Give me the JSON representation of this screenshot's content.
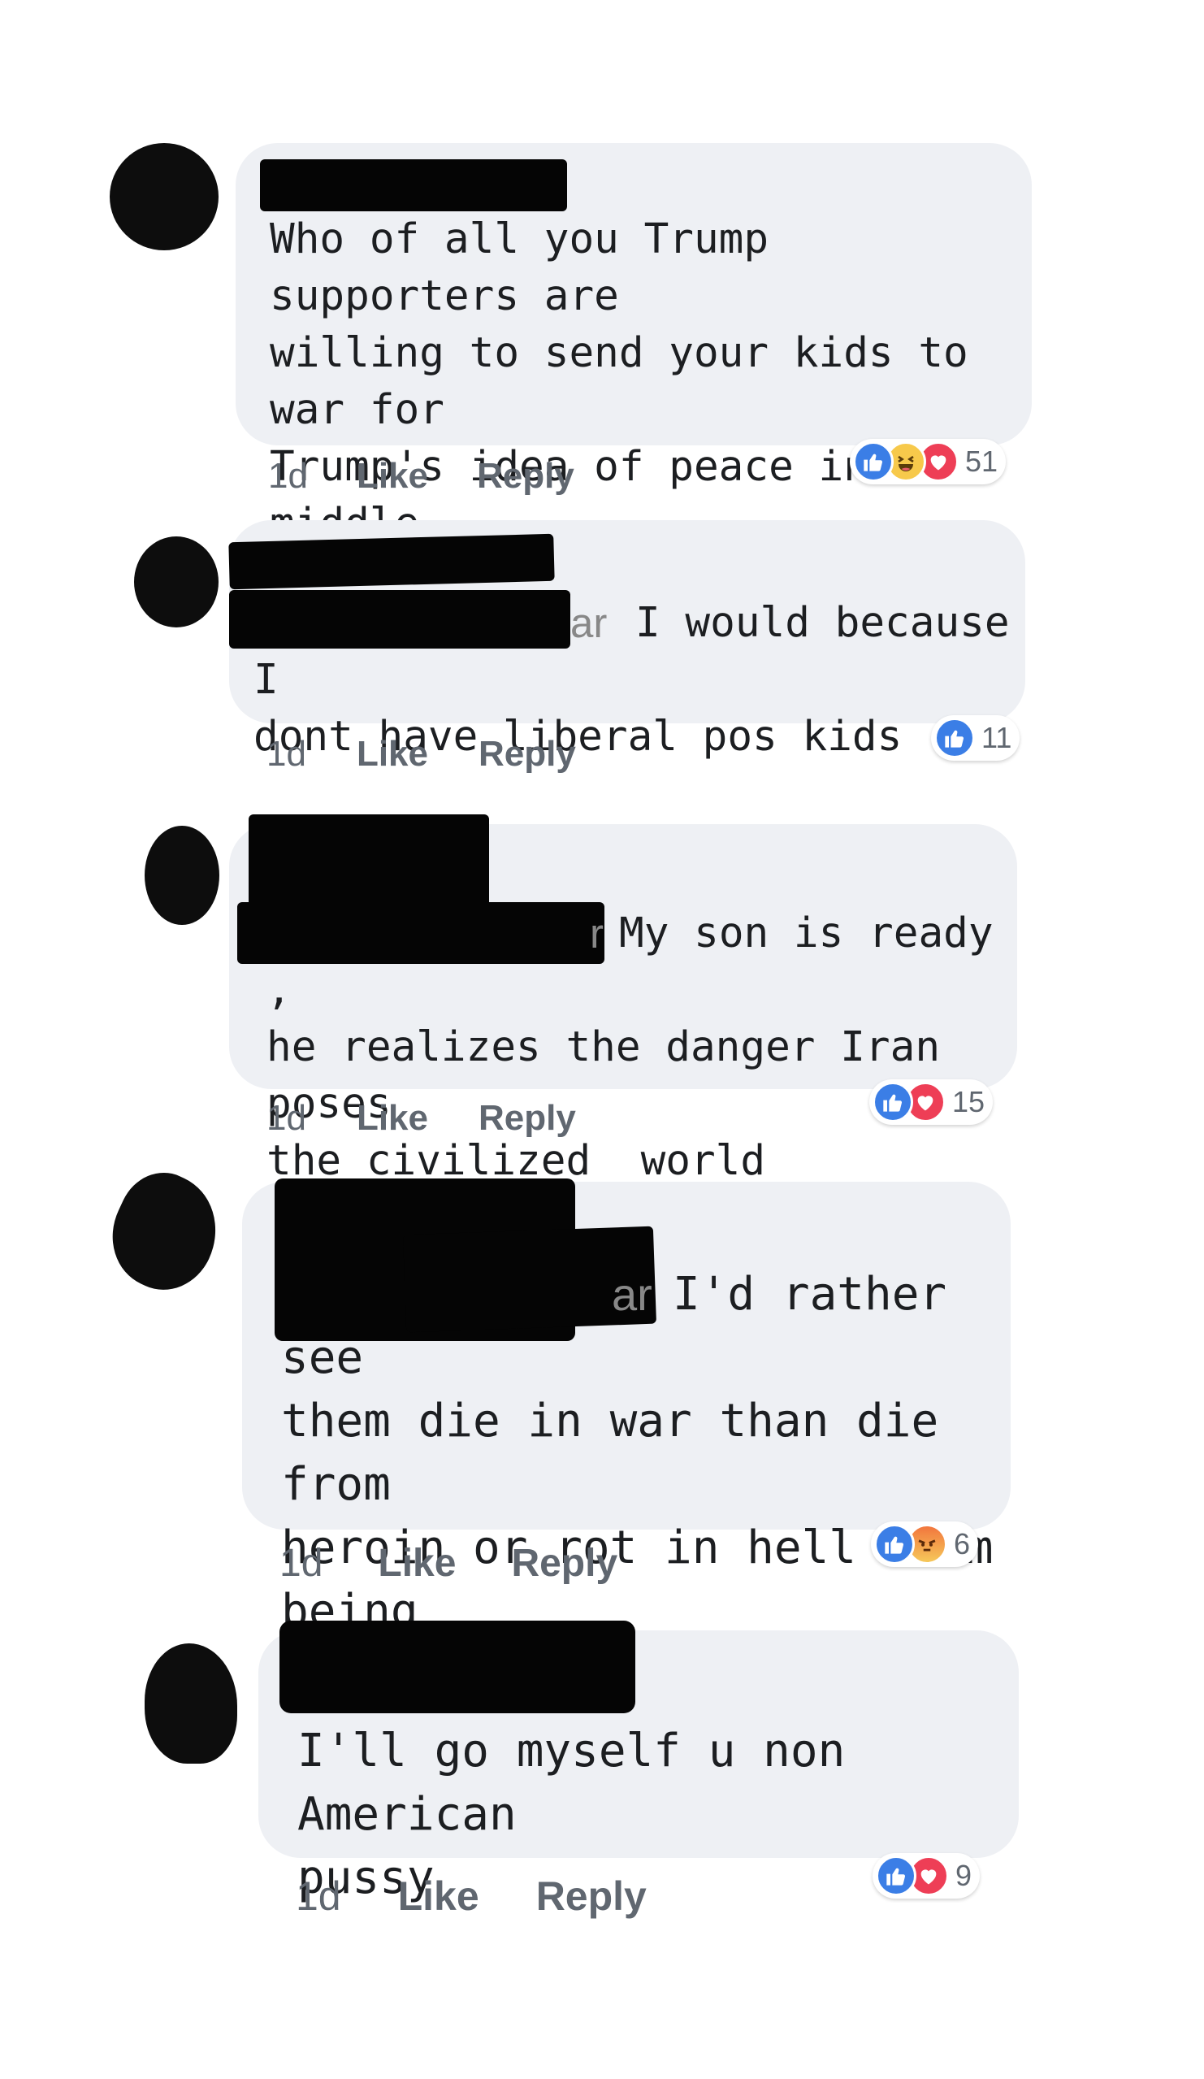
{
  "comments": [
    {
      "text": "Who of all you Trump supporters are\nwilling to send your kids to war for\nTrump's idea of peace in the middle\neast?",
      "time": "1d",
      "like_label": "Like",
      "reply_label": "Reply",
      "reactions": [
        "like-icon",
        "haha-icon",
        "love-icon"
      ],
      "reaction_count": "51"
    },
    {
      "text_fragment": "ar",
      "text": "I would because I\ndont have liberal pos kids",
      "time": "1d",
      "like_label": "Like",
      "reply_label": "Reply",
      "reactions": [
        "like-icon"
      ],
      "reaction_count": "11"
    },
    {
      "text_fragment": "r",
      "text": "My son is ready ,\nhe realizes the danger Iran poses\nthe civilized  world",
      "time": "1d",
      "like_label": "Like",
      "reply_label": "Reply",
      "reactions": [
        "like-icon",
        "love-icon"
      ],
      "reaction_count": "15"
    },
    {
      "text_fragment": "ar",
      "text": "I'd rather see\nthem die in war than die from\nheroin or rot in hell from being\nhomosexual",
      "time": "1d",
      "like_label": "Like",
      "reply_label": "Reply",
      "reactions": [
        "like-icon",
        "angry-icon"
      ],
      "reaction_count": "6"
    },
    {
      "text": "I'll go myself u non American\npussy",
      "time": "1d",
      "like_label": "Like",
      "reply_label": "Reply",
      "reactions": [
        "like-icon",
        "love-icon"
      ],
      "reaction_count": "9"
    }
  ],
  "colors": {
    "bubble": "#eef0f4",
    "like": "#3b7ee6",
    "love": "#ee3e56",
    "haha": "#f7c94b",
    "text": "#1c1e21",
    "meta": "#606770"
  }
}
